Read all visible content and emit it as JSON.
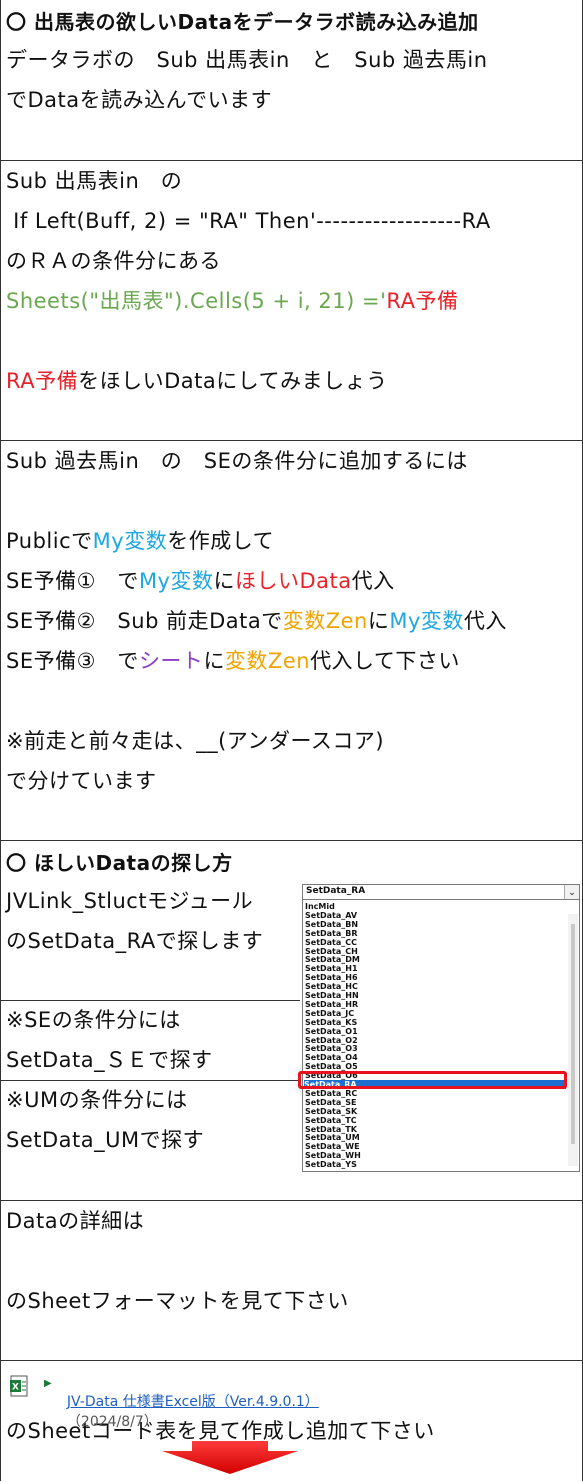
{
  "section1": {
    "heading": "〇 出馬表の欲しいDataをデータラボ読み込み追加",
    "line1": "データラボの　Sub 出馬表in　と　Sub 過去馬in",
    "line2": "でDataを読み込んでいます"
  },
  "section2": {
    "line1": "Sub 出馬表in　の",
    "line2": " If Left(Buff, 2) = \"RA\" Then'------------------RA",
    "line3": "のＲＡの条件分にある",
    "line4_green": "Sheets(\"出馬表\").Cells(5 + i, 21) ='",
    "line4_red": "RA予備",
    "line5_red": "RA予備",
    "line5_rest": "をほしいDataにしてみましょう"
  },
  "section3": {
    "line1": "Sub 過去馬in　の　SEの条件分に追加するには",
    "line2a": "Publicで",
    "line2b": "My変数",
    "line2c": "を作成して",
    "line3a": "SE予備①　で",
    "line3b": "My変数",
    "line3c": "に",
    "line3d": "ほしいData",
    "line3e": "代入",
    "line4a": "SE予備②　Sub 前走Dataで",
    "line4b": "変数Zen",
    "line4c": "に",
    "line4d": "My変数",
    "line4e": "代入",
    "line5a": "SE予備③　で",
    "line5b": "シート",
    "line5c": "に",
    "line5d": "変数Zen",
    "line5e": "代入して下さい",
    "line6": "※前走と前々走は、__(アンダースコア)",
    "line7": "で分けています"
  },
  "section4": {
    "heading": "〇 ほしいDataの探し方",
    "line1": "JVLink_Stluctモジュール",
    "line2": "のSetData_RAで探します",
    "line3": "※SEの条件分には",
    "line4": "SetData_ＳＥで探す",
    "line5": "※UMの条件分には",
    "line6": "SetData_UMで探す",
    "combo_value": "SetData_RA",
    "list_items": [
      "IncMid",
      "SetData_AV",
      "SetData_BN",
      "SetData_BR",
      "SetData_CC",
      "SetData_CH",
      "SetData_DM",
      "SetData_H1",
      "SetData_H6",
      "SetData_HC",
      "SetData_HN",
      "SetData_HR",
      "SetData_JC",
      "SetData_KS",
      "SetData_O1",
      "SetData_O2",
      "SetData_O3",
      "SetData_O4",
      "SetData_O5",
      "SetData_O6",
      "SetData_RA",
      "SetData_RC",
      "SetData_SE",
      "SetData_SK",
      "SetData_TC",
      "SetData_TK",
      "SetData_UM",
      "SetData_WE",
      "SetData_WH",
      "SetData_YS"
    ],
    "selected_item": "SetData_RA"
  },
  "section5": {
    "line1": "Dataの詳細は",
    "line2": "のSheetフォーマットを見て下さい"
  },
  "section6": {
    "link_text": "JV-Data 仕様書Excel版（Ver.4.9.0.1）",
    "link_date": "（2024/8/7）",
    "line1": "のSheetコード表を見て作成し追加て下さい"
  },
  "colors": {
    "green": "#6aa84f",
    "red": "#e8222a",
    "cyan": "#1ea7e0",
    "orange": "#f0a400",
    "purple": "#8a3fc7",
    "link": "#1f5fbf",
    "selection": "#1c6fd1"
  },
  "icons": {
    "excel": "excel-file-icon",
    "arrow": "down-arrow-icon"
  }
}
